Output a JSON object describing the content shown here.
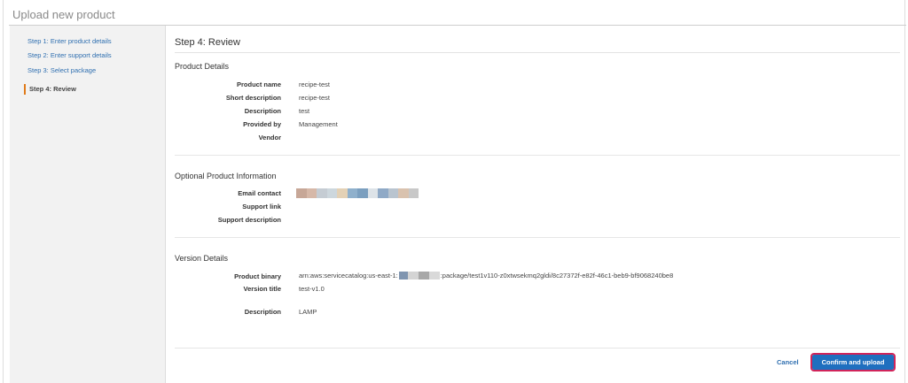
{
  "page": {
    "title": "Upload new product"
  },
  "sidebar": {
    "steps": [
      {
        "label": "Step 1: Enter product details"
      },
      {
        "label": "Step 2: Enter support details"
      },
      {
        "label": "Step 3: Select package"
      },
      {
        "label": "Step 4: Review"
      }
    ]
  },
  "main": {
    "heading": "Step 4: Review",
    "product_details": {
      "title": "Product Details",
      "fields": [
        {
          "label": "Product name",
          "value": "recipe-test"
        },
        {
          "label": "Short description",
          "value": "recipe-test"
        },
        {
          "label": "Description",
          "value": "test"
        },
        {
          "label": "Provided by",
          "value": "Management"
        },
        {
          "label": "Vendor",
          "value": ""
        }
      ]
    },
    "optional_info": {
      "title": "Optional Product Information",
      "fields": [
        {
          "label": "Email contact",
          "value": ""
        },
        {
          "label": "Support link",
          "value": ""
        },
        {
          "label": "Support description",
          "value": ""
        }
      ]
    },
    "version_details": {
      "title": "Version Details",
      "fields": [
        {
          "label": "Product binary",
          "value_prefix": "arn:aws:servicecatalog:us-east-1:",
          "value_suffix": ":package/test1v110-z0xtwsekmq2gldi/8c27372f-e82f-46c1-beb9-bf9068240be8"
        },
        {
          "label": "Version title",
          "value": "test-v1.0"
        },
        {
          "label": "Description",
          "value": "LAMP"
        }
      ]
    },
    "actions": {
      "cancel_label": "Cancel",
      "confirm_label": "Confirm and upload"
    }
  },
  "colors": {
    "link": "#2f6fb0",
    "current_step_marker": "#e07b1b",
    "primary_button": "#1f6fbf",
    "primary_button_focus_outline": "#d1245a",
    "sidebar_background": "#f2f2f2"
  },
  "redacted_email_colors": [
    "#c7a797",
    "#d6b8a8",
    "#c5ccd3",
    "#cdd7dd",
    "#e3d1b6",
    "#8fb0cc",
    "#7b9fbf",
    "#dde3e8",
    "#8fa9c6",
    "#b9c4cf",
    "#d9c2ae",
    "#c8c8c8"
  ],
  "redacted_account_colors": [
    "#7f95b0",
    "#d4d4d4",
    "#a8a8a8",
    "#d9d9d9"
  ]
}
